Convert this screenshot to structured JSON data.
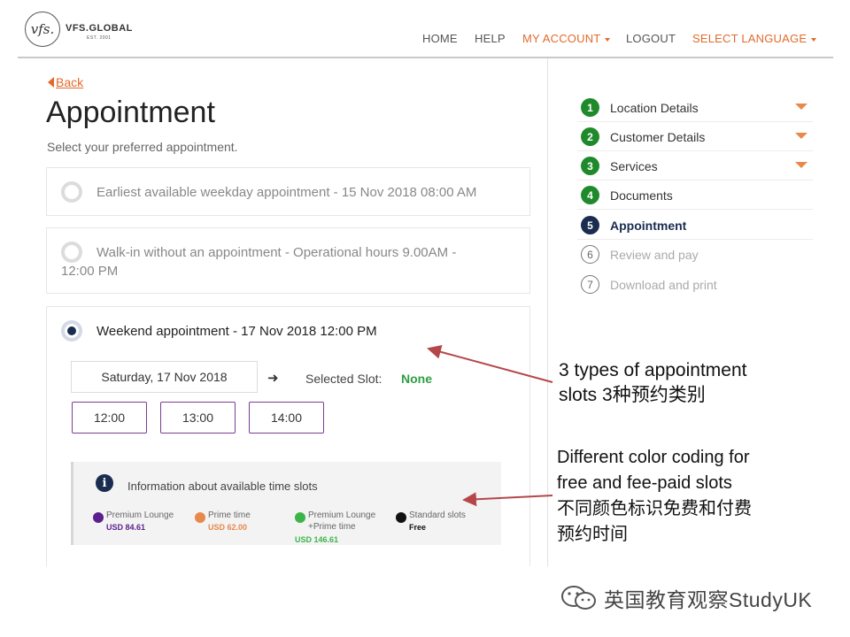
{
  "header": {
    "logo_mark": "vfs.",
    "logo_word": "VFS.GLOBAL",
    "logo_est": "EST. 2001",
    "nav": {
      "home": "HOME",
      "help": "HELP",
      "my_account": "MY ACCOUNT",
      "logout": "LOGOUT",
      "select_language": "SELECT LANGUAGE"
    },
    "accent_color": "#e26a2c"
  },
  "page": {
    "back_label": "Back",
    "title": "Appointment",
    "subtitle": "Select your preferred appointment."
  },
  "options": [
    {
      "label": "Earliest available weekday appointment - 15 Nov 2018 08:00 AM",
      "selected": false
    },
    {
      "label_line1": "Walk-in without an appointment - Operational hours 9.00AM -",
      "label_line2": "12:00 PM",
      "selected": false
    },
    {
      "label": "Weekend appointment - 17 Nov 2018 12:00 PM",
      "selected": true
    }
  ],
  "weekend": {
    "date": "Saturday, 17 Nov 2018",
    "selected_slot_label": "Selected Slot:",
    "selected_slot_value": "None",
    "slots": [
      "12:00",
      "13:00",
      "14:00"
    ]
  },
  "info": {
    "icon": "info-icon",
    "title": "Information about available time slots",
    "legend": [
      {
        "name": "Premium Lounge",
        "price": "USD 84.61",
        "color": "#5b1f8f",
        "price_color": "#5b1f8f"
      },
      {
        "name": "Prime time",
        "price": "USD 62.00",
        "color": "#e8884a",
        "price_color": "#e8884a"
      },
      {
        "name_line1": "Premium Lounge",
        "name_line2": "+Prime time",
        "price": "USD 146.61",
        "color": "#3bb54a",
        "price_color": "#3bb54a"
      },
      {
        "name": "Standard slots",
        "price": "Free",
        "color": "#111111",
        "price_color": "#111111"
      }
    ]
  },
  "steps": [
    {
      "number": "1",
      "label": "Location Details",
      "state": "done"
    },
    {
      "number": "2",
      "label": "Customer Details",
      "state": "done"
    },
    {
      "number": "3",
      "label": "Services",
      "state": "done"
    },
    {
      "number": "4",
      "label": "Documents",
      "state": "done"
    },
    {
      "number": "5",
      "label": "Appointment",
      "state": "current"
    },
    {
      "number": "6",
      "label": "Review and pay",
      "state": "pending"
    },
    {
      "number": "7",
      "label": "Download and print",
      "state": "pending"
    }
  ],
  "annotations": {
    "a1_line1": "3 types of appointment",
    "a1_line2": "slots 3种预约类别",
    "a2_line1": "Different color coding for",
    "a2_line2": "free and fee-paid slots",
    "a2_line3": "不同颜色标识免费和付费",
    "a2_line4": "预约时间",
    "arrow_color": "#b5474a"
  },
  "watermark": {
    "icon": "wechat-icon",
    "text": "英国教育观察StudyUK"
  }
}
